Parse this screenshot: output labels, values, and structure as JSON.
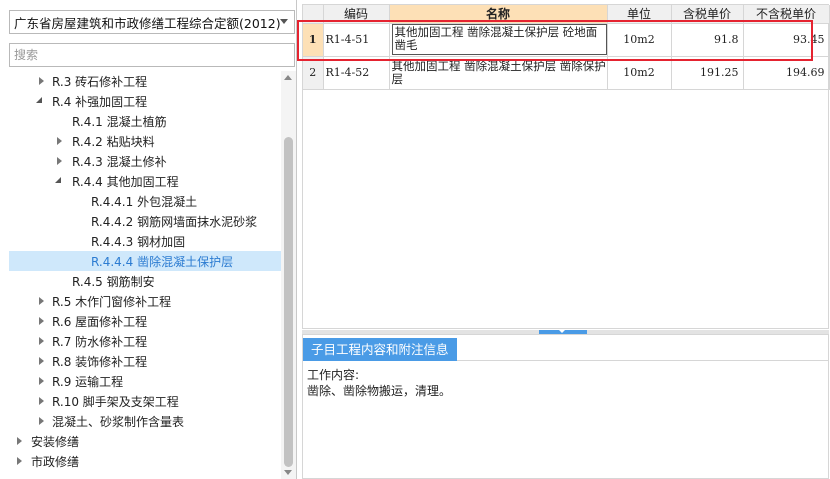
{
  "quota_select": {
    "value": "广东省房屋建筑和市政修缮工程综合定额(2012)"
  },
  "search": {
    "placeholder": "搜索"
  },
  "tree": [
    {
      "label": "R.3 砖石修补工程",
      "toggle": "collapsed"
    },
    {
      "label": "R.4 补强加固工程",
      "toggle": "expanded"
    },
    {
      "label": "R.4.1 混凝土植筋",
      "toggle": "none"
    },
    {
      "label": "R.4.2 粘贴块料",
      "toggle": "collapsed"
    },
    {
      "label": "R.4.3 混凝土修补",
      "toggle": "collapsed"
    },
    {
      "label": "R.4.4 其他加固工程",
      "toggle": "expanded"
    },
    {
      "label": "R.4.4.1 外包混凝土",
      "toggle": "none"
    },
    {
      "label": "R.4.4.2 钢筋网墙面抹水泥砂浆",
      "toggle": "none"
    },
    {
      "label": "R.4.4.3 钢材加固",
      "toggle": "none"
    },
    {
      "label": "R.4.4.4 凿除混凝土保护层",
      "toggle": "none",
      "selected": true
    },
    {
      "label": "R.4.5 钢筋制安",
      "toggle": "none"
    },
    {
      "label": "R.5 木作门窗修补工程",
      "toggle": "collapsed"
    },
    {
      "label": "R.6 屋面修补工程",
      "toggle": "collapsed"
    },
    {
      "label": "R.7 防水修补工程",
      "toggle": "collapsed"
    },
    {
      "label": "R.8 装饰修补工程",
      "toggle": "collapsed"
    },
    {
      "label": "R.9 运输工程",
      "toggle": "collapsed"
    },
    {
      "label": "R.10 脚手架及支架工程",
      "toggle": "collapsed"
    },
    {
      "label": "混凝土、砂浆制作含量表",
      "toggle": "collapsed"
    },
    {
      "label": "安装修缮",
      "toggle": "collapsed"
    },
    {
      "label": "市政修缮",
      "toggle": "collapsed"
    }
  ],
  "table": {
    "headers": {
      "code": "编码",
      "name": "名称",
      "unit": "单位",
      "tax_incl": "含税单价",
      "tax_excl": "不含税单价"
    },
    "rows": [
      {
        "index": "1",
        "code": "R1-4-51",
        "name": "其他加固工程 凿除混凝土保护层 砼地面凿毛",
        "unit": "10m2",
        "tax_incl": "91.8",
        "tax_excl": "93.45"
      },
      {
        "index": "2",
        "code": "R1-4-52",
        "name": "其他加固工程 凿除混凝土保护层 凿除保护层",
        "unit": "10m2",
        "tax_incl": "191.25",
        "tax_excl": "194.69"
      }
    ]
  },
  "info_panel": {
    "tab_label": "子目工程内容和附注信息",
    "work_content_label": "工作内容:",
    "work_content_text": "凿除、凿除物搬运，清理。"
  },
  "colors": {
    "accent": "#4a9be6",
    "highlight": "#e52330",
    "selected_header": "#fde0b6",
    "tree_selected": "#cfe8fb"
  }
}
